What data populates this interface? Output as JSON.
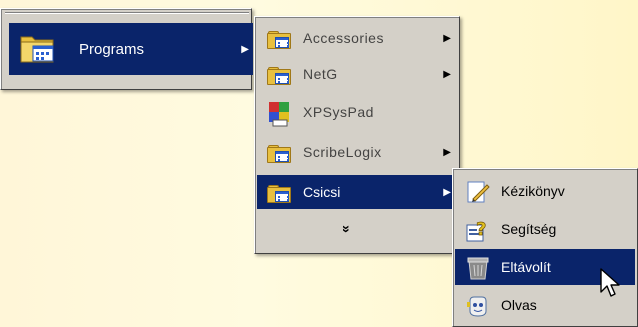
{
  "start_menu": {
    "items": [
      {
        "label": "Programs",
        "icon": "programs-folder-icon"
      }
    ]
  },
  "programs_menu": {
    "items": [
      {
        "label": "Accessories",
        "icon": "program-group-icon"
      },
      {
        "label": "NetG",
        "icon": "program-group-icon"
      },
      {
        "label": "XPSysPad",
        "icon": "xpsyspad-icon"
      },
      {
        "label": "ScribeLogix",
        "icon": "program-group-icon"
      },
      {
        "label": "Csicsi",
        "icon": "program-group-icon"
      }
    ],
    "expand_glyph": "»",
    "arrow_glyph": "▶"
  },
  "csicsi_menu": {
    "items": [
      {
        "label": "Kézikönyv",
        "icon": "manual-pencil-icon"
      },
      {
        "label": "Segítség",
        "icon": "help-icon"
      },
      {
        "label": "Eltávolít",
        "icon": "uninstall-bin-icon"
      },
      {
        "label": "Olvas",
        "icon": "read-icon"
      }
    ]
  },
  "colors": {
    "menu_bg": "#d4d0c8",
    "selection": "#0a246a",
    "desktop": "#fff8d8"
  }
}
